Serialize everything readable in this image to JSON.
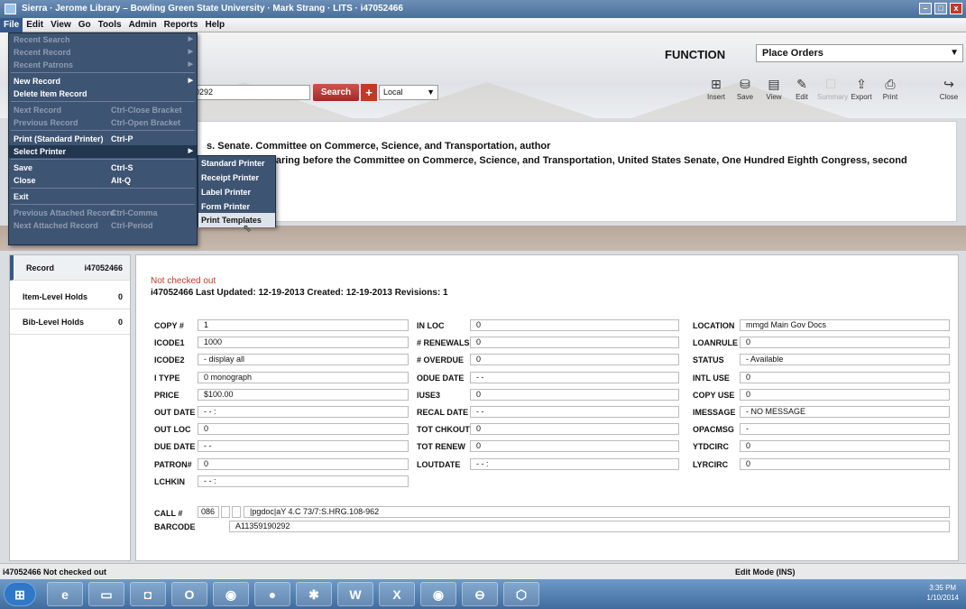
{
  "window": {
    "title": "Sierra · Jerome Library – Bowling Green State University · Mark Strang · LITS · i47052466"
  },
  "menubar": [
    "File",
    "Edit",
    "View",
    "Go",
    "Tools",
    "Admin",
    "Reports",
    "Help"
  ],
  "function": {
    "label": "FUNCTION",
    "value": "Place Orders"
  },
  "search": {
    "value": "90292",
    "button": "Search",
    "scope": "Local"
  },
  "toolbar": [
    {
      "label": "Insert",
      "icon": "insert-icon"
    },
    {
      "label": "Save",
      "icon": "save-icon"
    },
    {
      "label": "View",
      "icon": "view-icon"
    },
    {
      "label": "Edit",
      "icon": "edit-icon"
    },
    {
      "label": "Summary",
      "icon": "summary-icon"
    },
    {
      "label": "Export",
      "icon": "export-icon"
    },
    {
      "label": "Print",
      "icon": "print-icon"
    },
    {
      "label": "Close",
      "icon": "close-icon"
    }
  ],
  "bib": {
    "line1": "s. Senate. Committee on Commerce, Science, and Transportation, author",
    "line2": "hearing before the Committee on Commerce, Science, and Transportation, United States Senate, One Hundred Eighth Congress, second"
  },
  "file_menu": [
    {
      "label": "Recent Search",
      "shortcut": "",
      "sub": true,
      "disabled": true
    },
    {
      "label": "Recent Record",
      "shortcut": "",
      "sub": true,
      "disabled": true
    },
    {
      "label": "Recent Patrons",
      "shortcut": "",
      "sub": true,
      "disabled": true
    },
    {
      "label": "New Record",
      "shortcut": "",
      "sub": true,
      "disabled": false
    },
    {
      "label": "Delete Item Record",
      "shortcut": "",
      "sub": false,
      "disabled": false
    },
    {
      "label": "Next Record",
      "shortcut": "Ctrl-Close Bracket",
      "sub": false,
      "disabled": true
    },
    {
      "label": "Previous Record",
      "shortcut": "Ctrl-Open Bracket",
      "sub": false,
      "disabled": true
    },
    {
      "label": "Print (Standard Printer)",
      "shortcut": "Ctrl-P",
      "sub": false,
      "disabled": false
    },
    {
      "label": "Select Printer",
      "shortcut": "",
      "sub": true,
      "disabled": false
    },
    {
      "label": "Save",
      "shortcut": "Ctrl-S",
      "sub": false,
      "disabled": false
    },
    {
      "label": "Close",
      "shortcut": "Alt-Q",
      "sub": false,
      "disabled": false
    },
    {
      "label": "Exit",
      "shortcut": "",
      "sub": false,
      "disabled": false
    },
    {
      "label": "Previous Attached Record",
      "shortcut": "Ctrl-Comma",
      "sub": false,
      "disabled": true
    },
    {
      "label": "Next Attached Record",
      "shortcut": "Ctrl-Period",
      "sub": false,
      "disabled": true
    }
  ],
  "printer_menu": [
    "Standard Printer",
    "Receipt Printer",
    "Label Printer",
    "Form Printer",
    "Print Templates"
  ],
  "left_tabs": [
    {
      "label": "Record",
      "count": "i47052466"
    },
    {
      "label": "Item-Level Holds",
      "count": "0"
    },
    {
      "label": "Bib-Level Holds",
      "count": "0"
    }
  ],
  "record": {
    "status": "Not checked out",
    "line": "i47052466    Last Updated: 12-19-2013    Created: 12-19-2013    Revisions: 1"
  },
  "fields_col1": [
    [
      "COPY #",
      "1"
    ],
    [
      "ICODE1",
      "1000"
    ],
    [
      "ICODE2",
      "- display all"
    ],
    [
      "I TYPE",
      "0 monograph"
    ],
    [
      "PRICE",
      "$100.00"
    ],
    [
      "OUT DATE",
      "- -   :"
    ],
    [
      "OUT LOC",
      "0"
    ],
    [
      "DUE DATE",
      "- -"
    ],
    [
      "PATRON#",
      "0"
    ],
    [
      "LCHKIN",
      "- -   :"
    ]
  ],
  "fields_col2": [
    [
      "IN LOC",
      "0"
    ],
    [
      "# RENEWALS",
      "0"
    ],
    [
      "# OVERDUE",
      "0"
    ],
    [
      "ODUE DATE",
      "- -"
    ],
    [
      "IUSE3",
      "0"
    ],
    [
      "RECAL DATE",
      "- -"
    ],
    [
      "TOT CHKOUT",
      "0"
    ],
    [
      "TOT RENEW",
      "0"
    ],
    [
      "LOUTDATE",
      "- -   :"
    ]
  ],
  "fields_col3": [
    [
      "LOCATION",
      "mmgd  Main Gov Docs"
    ],
    [
      "LOANRULE",
      "0"
    ],
    [
      "STATUS",
      "- Available"
    ],
    [
      "INTL USE",
      "0"
    ],
    [
      "COPY USE",
      "0"
    ],
    [
      "IMESSAGE",
      "- NO MESSAGE"
    ],
    [
      "OPACMSG",
      "-"
    ],
    [
      "YTDCIRC",
      "0"
    ],
    [
      "LYRCIRC",
      "0"
    ]
  ],
  "call": {
    "label": "CALL #",
    "tag": "086",
    "value": "|pgdoc|aY 4.C 73/7:S.HRG.108-962"
  },
  "barcode": {
    "label": "BARCODE",
    "value": "A11359190292"
  },
  "statusbar": {
    "left": "i47052466  Not checked out",
    "mode": "Edit Mode (INS)"
  },
  "clock": {
    "time": "3:35 PM",
    "date": "1/10/2014"
  }
}
